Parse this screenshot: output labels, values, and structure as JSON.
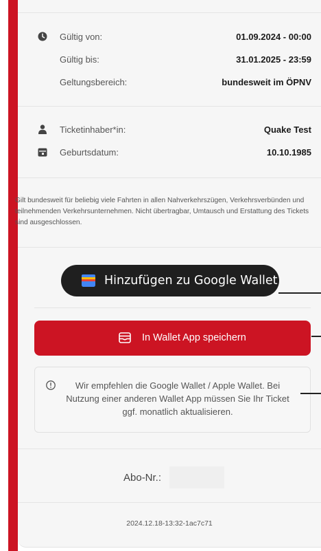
{
  "validity": {
    "from_label": "Gültig von:",
    "from_value": "01.09.2024 - 00:00",
    "to_label": "Gültig bis:",
    "to_value": "31.01.2025 - 23:59",
    "area_label": "Geltungsbereich:",
    "area_value": "bundesweit im ÖPNV",
    "icon": "clock-icon"
  },
  "holder": {
    "name_label": "Ticketinhaber*in:",
    "name_value": "Quake Test",
    "birth_label": "Geburtsdatum:",
    "birth_value": "10.10.1985",
    "name_icon": "person-icon",
    "birth_icon": "calendar-icon"
  },
  "description": "Gilt bundesweit für beliebig viele Fahrten in allen Nahverkehrszügen, Verkehrsverbünden und teilnehmenden Verkehrsunternehmen. Nicht übertragbar, Umtausch und Erstattung des Tickets sind ausgeschlossen.",
  "google_wallet": {
    "label": "Hinzufügen zu Google Wallet",
    "icon": "google-wallet-icon"
  },
  "wallet_app": {
    "label": "In Wallet App speichern",
    "icon": "wallet-icon"
  },
  "info": {
    "text": "Wir empfehlen die Google Wallet / Apple Wallet. Bei Nutzung einer anderen Wallet App müssen Sie Ihr Ticket ggf. monatlich aktualisieren.",
    "icon": "info-icon"
  },
  "subscription": {
    "label": "Abo-Nr.:",
    "value": ""
  },
  "version": "2024.12.18-13:32-1ac7c71",
  "colors": {
    "accent": "#cc1423",
    "dark_button": "#1f1f1f",
    "card_bg": "#f6f6f6"
  }
}
